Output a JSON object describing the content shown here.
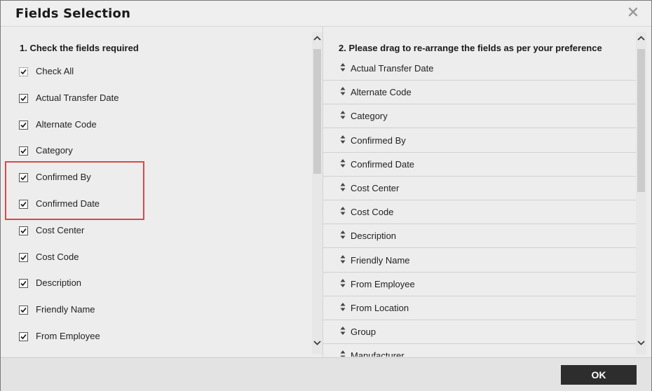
{
  "dialog": {
    "title": "Fields Selection",
    "close_icon": "close-icon"
  },
  "left": {
    "title": "1. Check the fields required",
    "items": [
      {
        "label": "Check All",
        "checked": true
      },
      {
        "label": "Actual Transfer Date",
        "checked": true
      },
      {
        "label": "Alternate Code",
        "checked": true
      },
      {
        "label": "Category",
        "checked": true
      },
      {
        "label": "Confirmed By",
        "checked": true
      },
      {
        "label": "Confirmed Date",
        "checked": true
      },
      {
        "label": "Cost Center",
        "checked": true
      },
      {
        "label": "Cost Code",
        "checked": true
      },
      {
        "label": "Description",
        "checked": true
      },
      {
        "label": "Friendly Name",
        "checked": true
      },
      {
        "label": "From Employee",
        "checked": true
      }
    ]
  },
  "right": {
    "title": "2. Please drag to re-arrange the fields as per your preference",
    "items": [
      {
        "label": "Actual Transfer Date"
      },
      {
        "label": "Alternate Code"
      },
      {
        "label": "Category"
      },
      {
        "label": "Confirmed By"
      },
      {
        "label": "Confirmed Date"
      },
      {
        "label": "Cost Center"
      },
      {
        "label": "Cost Code"
      },
      {
        "label": "Description"
      },
      {
        "label": "Friendly Name"
      },
      {
        "label": "From Employee"
      },
      {
        "label": "From Location"
      },
      {
        "label": "Group"
      },
      {
        "label": "Manufacturer"
      }
    ]
  },
  "footer": {
    "ok_label": "OK"
  },
  "colors": {
    "highlight": "#e04646",
    "button_bg": "#2d2d2d"
  }
}
